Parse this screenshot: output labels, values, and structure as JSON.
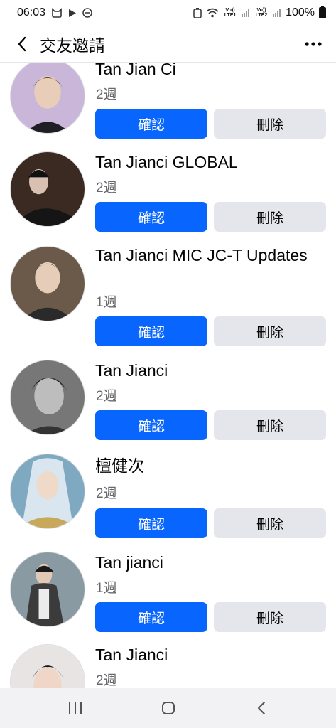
{
  "status_bar": {
    "time": "06:03",
    "battery": "100%",
    "sim1": "Vo)) LTE1",
    "sim2": "Vo)) LTE2",
    "icons": [
      "cat-icon",
      "play-icon",
      "minus-circle-icon",
      "recycle-icon",
      "wifi-icon",
      "signal-icon",
      "battery-icon"
    ]
  },
  "header": {
    "title": "交友邀請",
    "back_icon": "back-arrow-icon",
    "more_icon": "more-dots-icon"
  },
  "requests": [
    {
      "name": "Tan Jian Ci",
      "time": "2週",
      "confirm": "確認",
      "delete": "刪除",
      "avatar_color": "#c9b6d8"
    },
    {
      "name": "Tan Jianci  GLOBAL",
      "time": "2週",
      "confirm": "確認",
      "delete": "刪除",
      "avatar_color": "#3a2a22"
    },
    {
      "name": "Tan Jianci MIC JC-T Updates",
      "time": "1週",
      "confirm": "確認",
      "delete": "刪除",
      "avatar_color": "#6b5a4a"
    },
    {
      "name": "Tan Jianci",
      "time": "2週",
      "confirm": "確認",
      "delete": "刪除",
      "avatar_color": "#777777"
    },
    {
      "name": "檀健次",
      "time": "2週",
      "confirm": "確認",
      "delete": "刪除",
      "avatar_color": "#7fa9c0"
    },
    {
      "name": "Tan jianci",
      "time": "1週",
      "confirm": "確認",
      "delete": "刪除",
      "avatar_color": "#8a9aa3"
    },
    {
      "name": "Tan Jianci",
      "time": "2週",
      "avatar_color": "#e9e4e4"
    }
  ],
  "nav_bar": {
    "icons": [
      "recent-apps-icon",
      "home-icon",
      "back-icon"
    ]
  },
  "colors": {
    "confirm_bg": "#0866ff",
    "delete_bg": "#e4e6eb",
    "secondary_text": "#65676b"
  }
}
